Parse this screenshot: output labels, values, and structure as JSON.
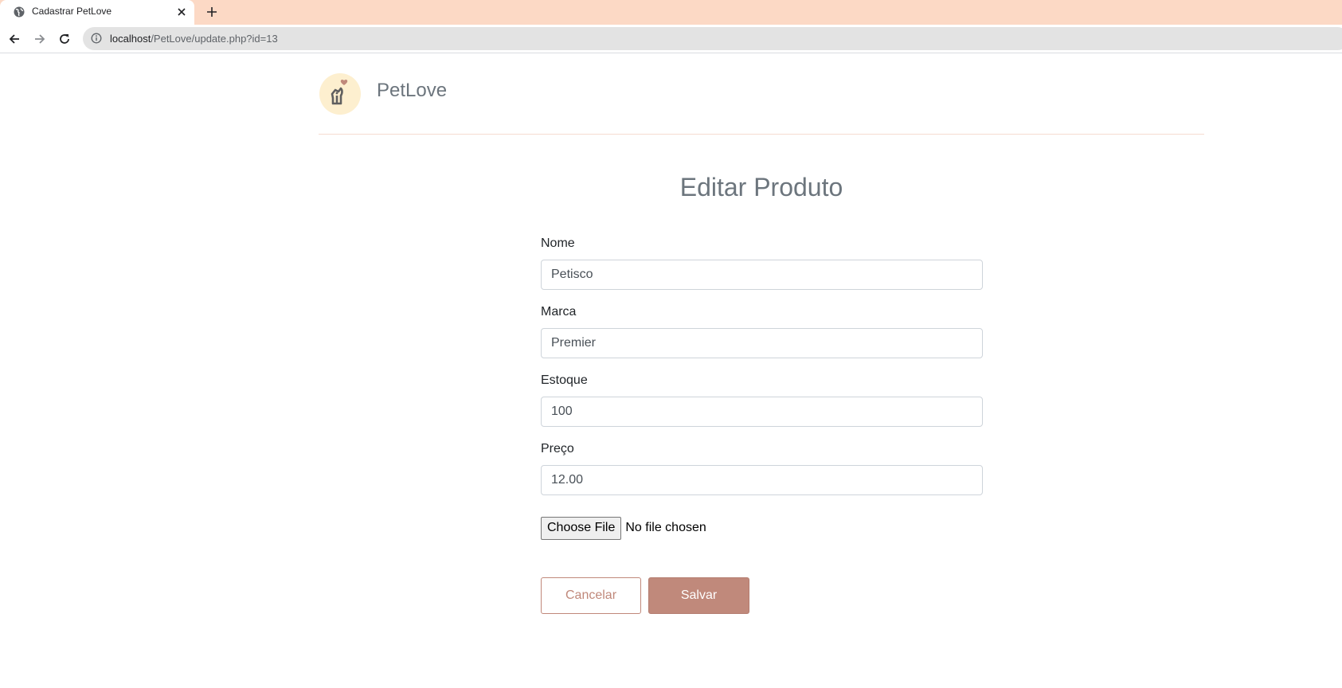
{
  "browser": {
    "tab_title": "Cadastrar PetLove",
    "url_host": "localhost",
    "url_path": "/PetLove/update.php?id=13"
  },
  "header": {
    "brand": "PetLove",
    "logo_bg": "#fdefcf"
  },
  "form": {
    "title": "Editar Produto",
    "fields": [
      {
        "label": "Nome",
        "value": "Petisco"
      },
      {
        "label": "Marca",
        "value": "Premier"
      },
      {
        "label": "Estoque",
        "value": "100"
      },
      {
        "label": "Preço",
        "value": "12.00"
      }
    ],
    "file_button": "Choose File",
    "file_status": "No file chosen",
    "cancel_label": "Cancelar",
    "save_label": "Salvar"
  },
  "colors": {
    "tab_strip": "#fcd9c5",
    "accent": "#c0897b",
    "muted_text": "#6c757d"
  },
  "icons": {
    "tab": "globe-icon",
    "close": "close-icon",
    "new_tab": "plus-icon",
    "back": "arrow-left-icon",
    "forward": "arrow-right-icon",
    "reload": "reload-icon",
    "site_info": "info-icon",
    "logo": "pet-heart-logo"
  }
}
